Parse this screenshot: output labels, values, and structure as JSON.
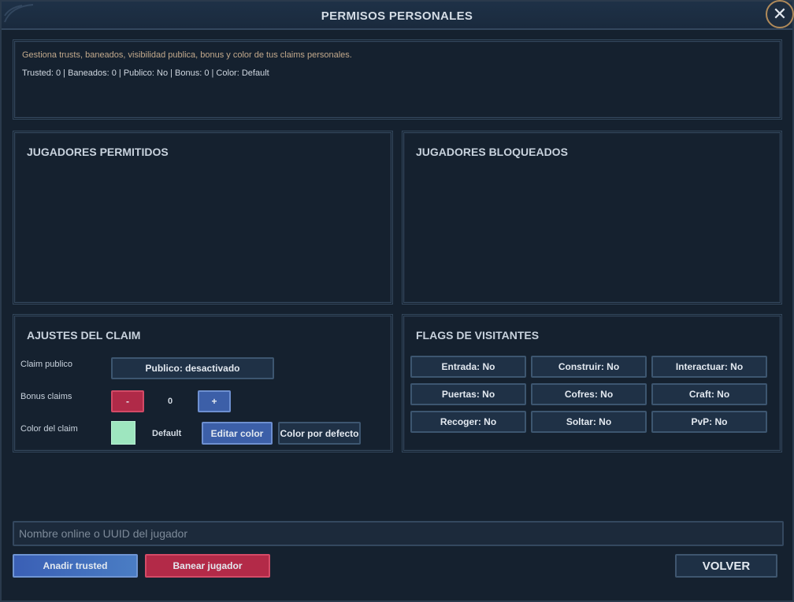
{
  "window": {
    "title": "PERMISOS PERSONALES",
    "close_glyph": "✕"
  },
  "info": {
    "description": "Gestiona trusts, baneados, visibilidad publica, bonus y color de tus claims personales.",
    "summary": "Trusted: 0 | Baneados: 0 | Publico: No | Bonus: 0 | Color: Default"
  },
  "allowed_players": {
    "title": "JUGADORES PERMITIDOS"
  },
  "blocked_players": {
    "title": "JUGADORES BLOQUEADOS"
  },
  "claim_settings": {
    "title": "AJUSTES DEL CLAIM",
    "public_label": "Claim publico",
    "public_button": "Publico: desactivado",
    "bonus_label": "Bonus claims",
    "bonus_minus": "-",
    "bonus_value": "0",
    "bonus_plus": "+",
    "color_label": "Color del claim",
    "color_swatch": "#9ee6bf",
    "color_name": "Default",
    "edit_color": "Editar color",
    "default_color": "Color por defecto"
  },
  "visitor_flags": {
    "title": "FLAGS DE VISITANTES",
    "flags": [
      "Entrada: No",
      "Construir: No",
      "Interactuar: No",
      "Puertas: No",
      "Cofres: No",
      "Craft: No",
      "Recoger: No",
      "Soltar: No",
      "PvP: No"
    ]
  },
  "player_input": {
    "placeholder": "Nombre online o UUID del jugador",
    "value": ""
  },
  "actions": {
    "add_trusted": "Anadir trusted",
    "ban_player": "Banear jugador",
    "back": "VOLVER"
  }
}
